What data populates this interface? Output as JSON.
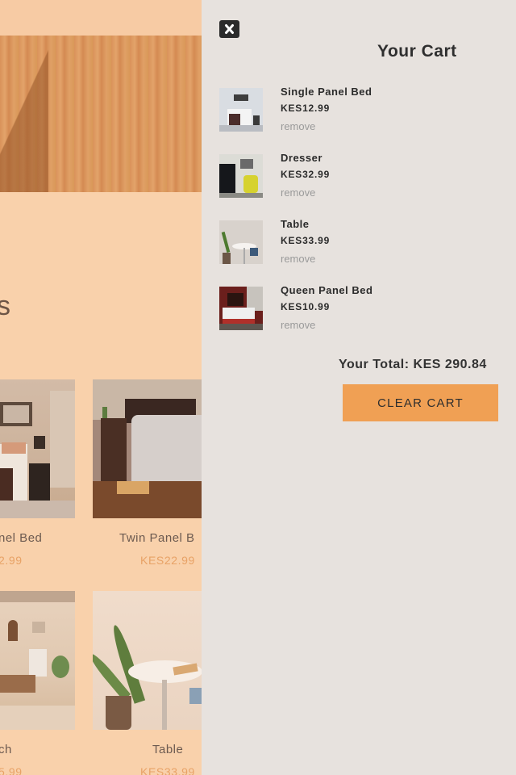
{
  "background_page": {
    "heading_fragment": "s",
    "products": [
      {
        "name": "nel Bed",
        "price": "2.99"
      },
      {
        "name": "Twin Panel B",
        "price": "KES22.99"
      },
      {
        "name": "ch",
        "price": "5.99"
      },
      {
        "name": "Table",
        "price": "KES33.99"
      }
    ]
  },
  "cart": {
    "title": "Your Cart",
    "close_icon": "close-icon",
    "items": [
      {
        "name": "Single Panel Bed",
        "price": "KES12.99",
        "remove_label": "remove"
      },
      {
        "name": "Dresser",
        "price": "KES32.99",
        "remove_label": "remove"
      },
      {
        "name": "Table",
        "price": "KES33.99",
        "remove_label": "remove"
      },
      {
        "name": "Queen Panel Bed",
        "price": "KES10.99",
        "remove_label": "remove"
      }
    ],
    "total_label": "Your Total: KES 290.84",
    "clear_button_label": "CLEAR CART"
  },
  "colors": {
    "overlay": "#f9d1ab",
    "cart_bg": "#e7e2de",
    "accent": "#f0a054",
    "price_accent": "#e8a266"
  }
}
